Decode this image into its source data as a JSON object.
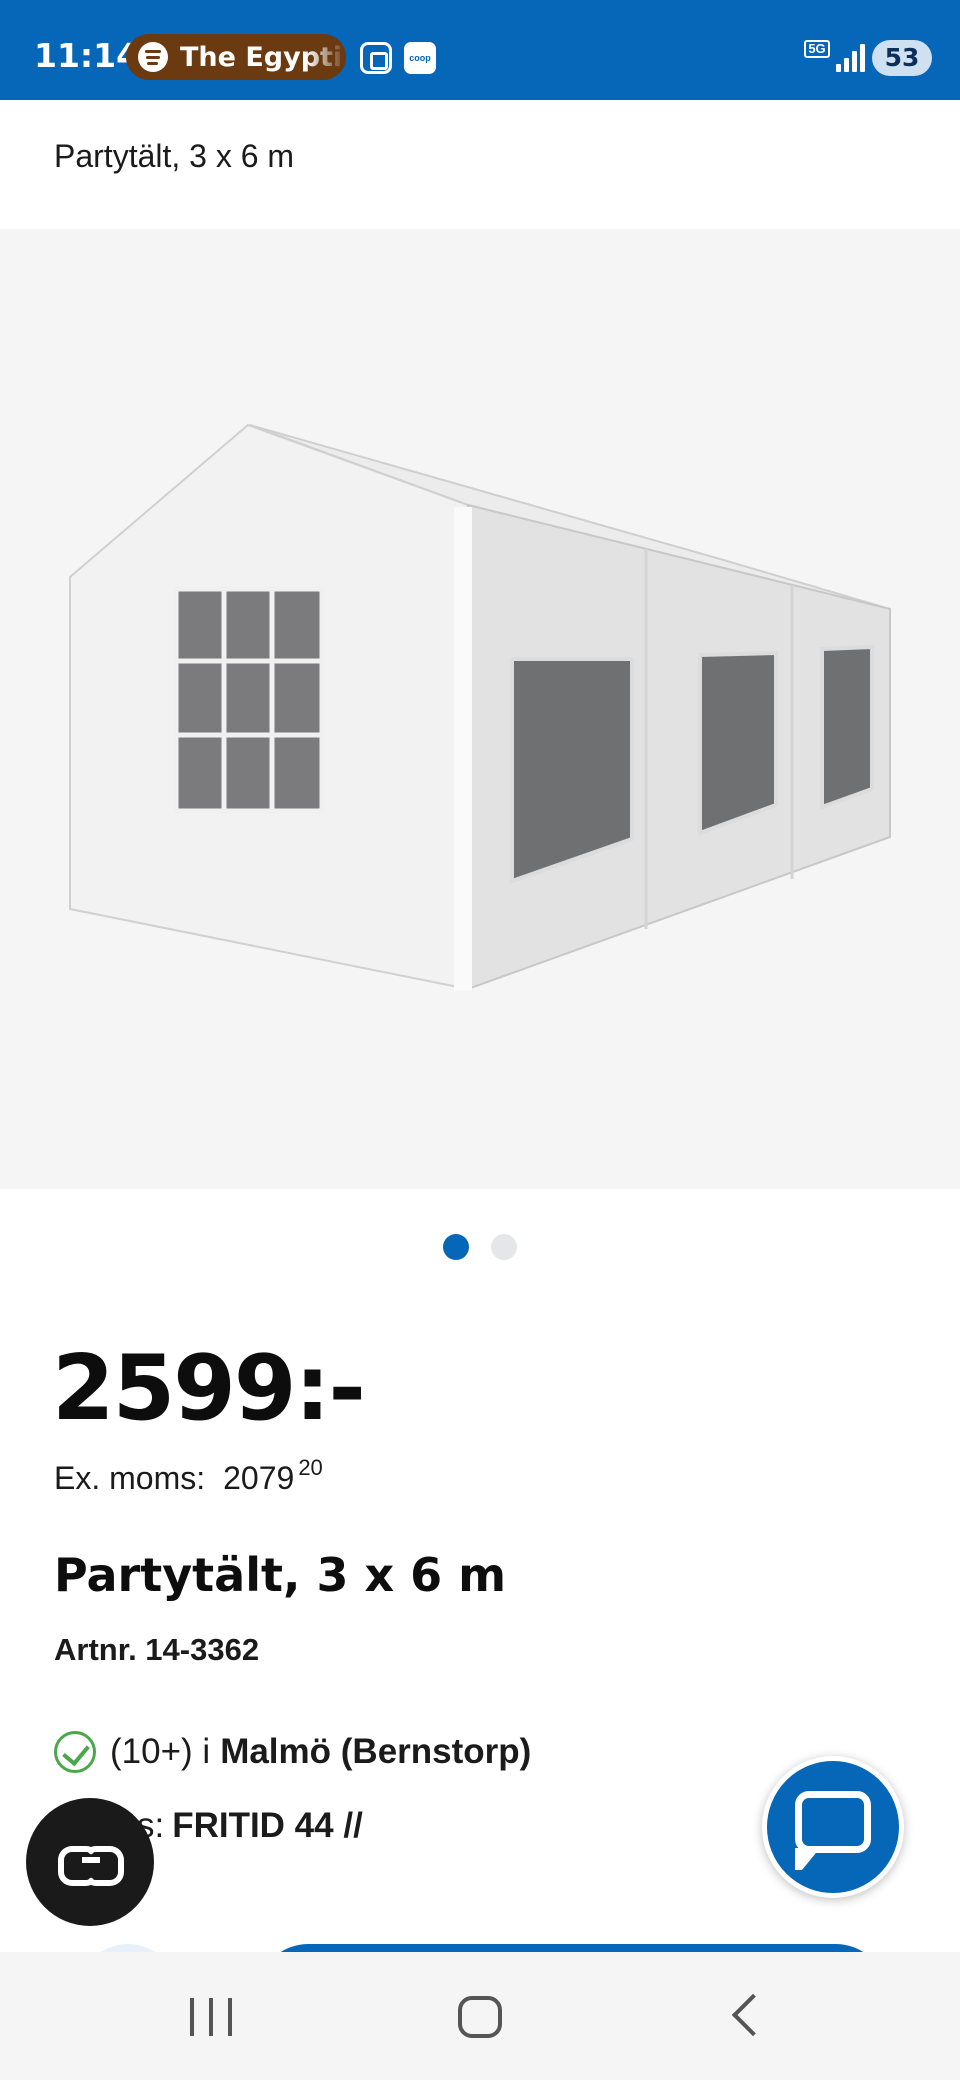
{
  "status_bar": {
    "time": "11:14",
    "media": "The Egypti",
    "coop_label": "coop",
    "network": "5G",
    "battery": "53"
  },
  "header": {
    "subtitle": "Partytält, 3 x 6 m"
  },
  "carousel": {
    "total": 2,
    "active_index": 0
  },
  "product": {
    "price": "2599:-",
    "ex_moms_label": "Ex. moms:",
    "ex_moms_value": "2079",
    "ex_moms_decimals": "20",
    "name": "Partytält, 3 x 6 m",
    "artnr": "Artnr. 14-3362",
    "stock_count": "(10+) i",
    "stock_store": "Malmö (Bernstorp)",
    "shelf_label": "lats:",
    "shelf_value": "FRITID 44 //"
  },
  "colors": {
    "brand_blue": "#0666b8",
    "stock_green": "#4aa84a"
  },
  "icons": {
    "accessibility": "glasses-icon",
    "chat": "chat-bubble-icon",
    "nav_recent": "recent-apps-icon",
    "nav_home": "home-icon",
    "nav_back": "back-icon"
  }
}
